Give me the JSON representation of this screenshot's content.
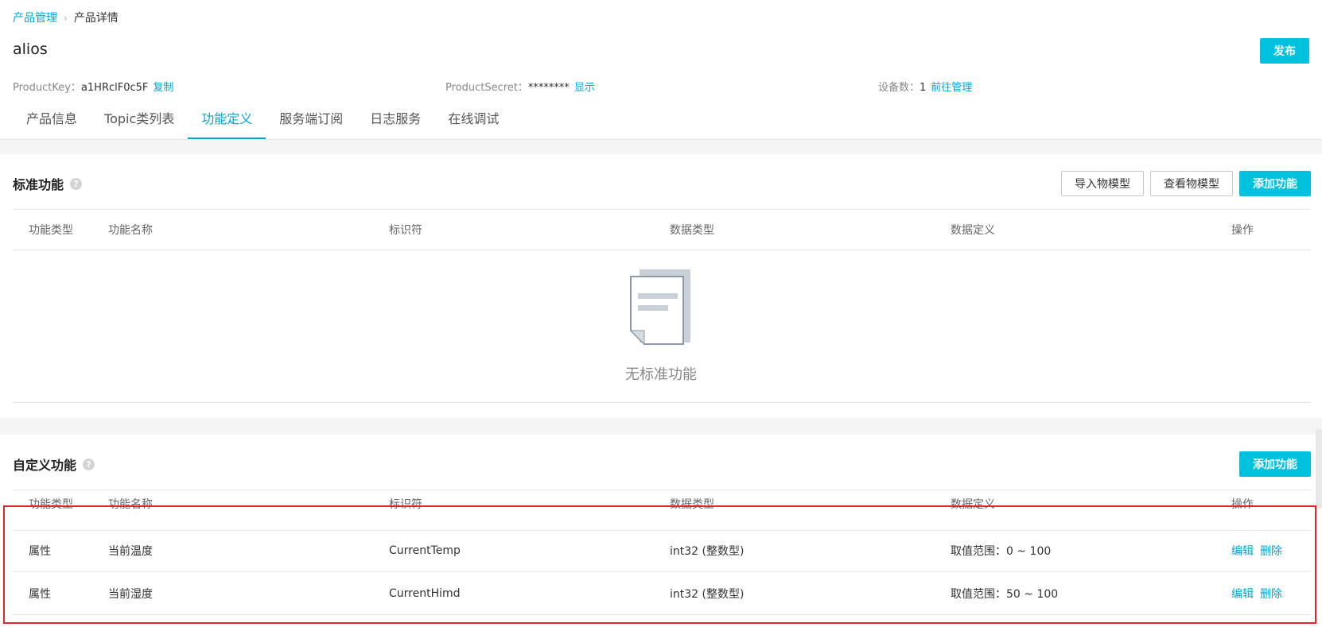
{
  "breadcrumb": {
    "root": "产品管理",
    "separator": "›",
    "current": "产品详情"
  },
  "page_title": "alios",
  "publish_label": "发布",
  "meta": {
    "product_key_label": "ProductKey：",
    "product_key_value": "a1HRclF0c5F",
    "copy_label": "复制",
    "product_secret_label": "ProductSecret：",
    "product_secret_value": "********",
    "show_label": "显示",
    "device_count_label": "设备数：",
    "device_count_value": "1",
    "manage_label": "前往管理"
  },
  "tabs": [
    {
      "label": "产品信息"
    },
    {
      "label": "Topic类列表"
    },
    {
      "label": "功能定义",
      "active": true
    },
    {
      "label": "服务端订阅"
    },
    {
      "label": "日志服务"
    },
    {
      "label": "在线调试"
    }
  ],
  "standard": {
    "title": "标准功能",
    "import_label": "导入物模型",
    "view_label": "查看物模型",
    "add_label": "添加功能",
    "empty_text": "无标准功能"
  },
  "custom": {
    "title": "自定义功能",
    "add_label": "添加功能"
  },
  "columns": {
    "type": "功能类型",
    "name": "功能名称",
    "identifier": "标识符",
    "data_type": "数据类型",
    "definition": "数据定义",
    "ops": "操作"
  },
  "rows": [
    {
      "type": "属性",
      "name": "当前温度",
      "identifier": "CurrentTemp",
      "data_type": "int32 (整数型)",
      "definition": "取值范围：0 ~ 100",
      "edit": "编辑",
      "delete": "删除"
    },
    {
      "type": "属性",
      "name": "当前湿度",
      "identifier": "CurrentHimd",
      "data_type": "int32 (整数型)",
      "definition": "取值范围：50 ~ 100",
      "edit": "编辑",
      "delete": "删除"
    }
  ],
  "icons": {
    "help": "question-icon",
    "empty": "document-icon"
  },
  "colors": {
    "accent": "#00a7d0",
    "primary_button": "#00c1de",
    "highlight": "#e4242a"
  }
}
